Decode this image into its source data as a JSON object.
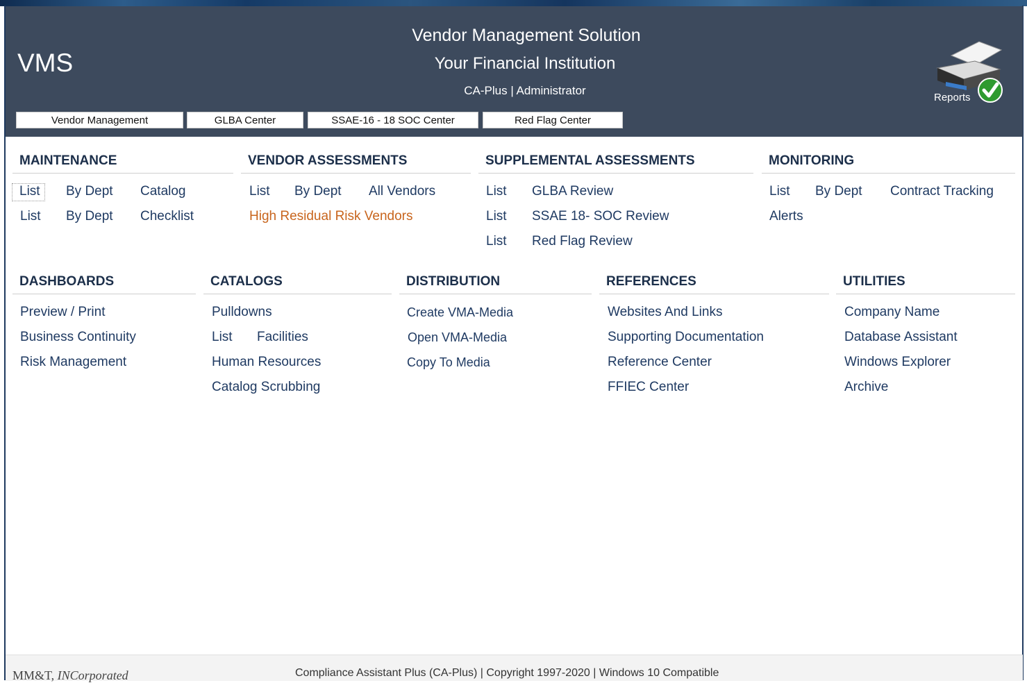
{
  "header": {
    "logo": "VMS",
    "title": "Vendor Management Solution",
    "institution": "Your Financial Institution",
    "user_line": "CA-Plus | Administrator",
    "tabs": [
      "Vendor Management",
      "GLBA Center",
      "SSAE-16 - 18  SOC Center",
      "Red Flag Center"
    ],
    "reports_label": "Reports",
    "reports_icon": "printer-check-icon"
  },
  "maintenance": {
    "title": "MAINTENANCE",
    "row1": [
      "List",
      "By Dept",
      "Catalog"
    ],
    "row2": [
      "List",
      "By Dept",
      "Checklist"
    ]
  },
  "vendor_assessments": {
    "title": "VENDOR ASSESSMENTS",
    "row1": [
      "List",
      "By Dept",
      "All Vendors"
    ],
    "high_risk": "High Residual Risk Vendors"
  },
  "supplemental": {
    "title": "SUPPLEMENTAL ASSESSMENTS",
    "rows": [
      {
        "list": "List",
        "item": "GLBA Review"
      },
      {
        "list": "List",
        "item": "SSAE 18- SOC Review"
      },
      {
        "list": "List",
        "item": "Red Flag Review"
      }
    ]
  },
  "monitoring": {
    "title": "MONITORING",
    "row1": [
      "List",
      "By Dept",
      "Contract Tracking"
    ],
    "alerts": "Alerts"
  },
  "dashboards": {
    "title": "DASHBOARDS",
    "items": [
      "Preview / Print",
      "Business Continuity",
      "Risk Management"
    ]
  },
  "catalogs": {
    "title": "CATALOGS",
    "pulldowns": "Pulldowns",
    "list": "List",
    "facilities": "Facilities",
    "human_resources": "Human Resources",
    "scrubbing": "Catalog Scrubbing"
  },
  "distribution": {
    "title": "DISTRIBUTION",
    "items": [
      "Create VMA-Media",
      "Open VMA-Media",
      "Copy To Media"
    ]
  },
  "references": {
    "title": "REFERENCES",
    "items": [
      "Websites And Links",
      "Supporting Documentation",
      "Reference Center",
      "FFIEC Center"
    ]
  },
  "utilities": {
    "title": "UTILITIES",
    "items": [
      "Company Name",
      "Database Assistant",
      "Windows Explorer",
      "Archive"
    ]
  },
  "footer": {
    "company": "MM&T, ",
    "company_italic": "INCorporated",
    "copyright": "Compliance Assistant Plus (CA-Plus) | Copyright 1997-2020 | Windows  10 Compatible"
  },
  "colors": {
    "header_bg": "#3d4a5d",
    "link": "#1f3a62",
    "highlight": "#c8651d"
  }
}
